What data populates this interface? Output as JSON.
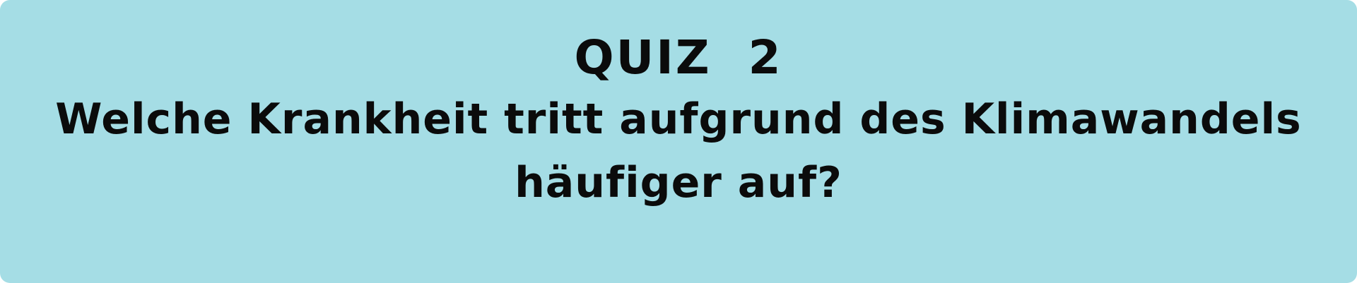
{
  "quiz": {
    "title": "QUIZ  2",
    "question_line1": "Welche Krankheit tritt aufgrund des Klimawandels",
    "question_line2": "häufiger auf?"
  },
  "colors": {
    "background": "#a5dde5",
    "text": "#0b0b0b"
  }
}
